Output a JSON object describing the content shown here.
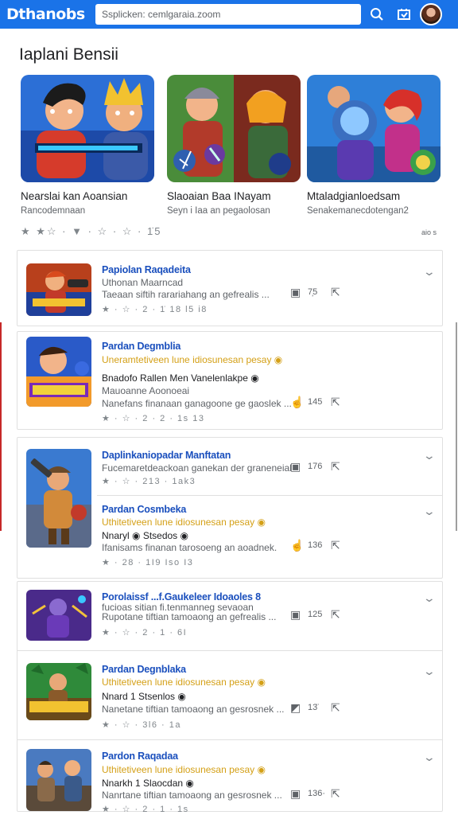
{
  "app": {
    "logo_text": "Dthanobs"
  },
  "search": {
    "placeholder": "Ssplicken: cemlgaraia.zoom"
  },
  "section": {
    "title": "Iaplani Bensii"
  },
  "featured": [
    {
      "title": "Nearslai kan Aoansian",
      "subtitle": "Rancodemnaan"
    },
    {
      "title": "Slaoaian Baa INayam",
      "subtitle": "Seyn i Iaa an pegaolosan"
    },
    {
      "title": "Mtaladgianloedsam",
      "subtitle": "Senakemanecdotengan2"
    }
  ],
  "featured_rating": {
    "text": "★ ★☆ · ▼ · ☆ · ☆ · 1̇5",
    "more": "aio s"
  },
  "list": [
    {
      "title": "Papiolan Raqadeita",
      "line1": "Uthonan Maarncad",
      "line2": "Taeaan siftih rarariahang an gefrealis ...",
      "rating": "★ · ☆ · 2 · 1̇ 18 l5 i8",
      "count": "7̦5"
    },
    {
      "title": "Pardan Degmblia",
      "line1": "Uneramtetiveen lune idiosunesan pesay ◉",
      "line2": "Bnadofo Rallen Men Vanelenlakpe ◉",
      "line3": "Mauoanne Aoonoeai",
      "line4": "Nanefans finanaan ganagoone ge gaoslek ...",
      "rating": "★ · ☆ · 2 ·  2 · 1s 13",
      "count": "145"
    },
    {
      "title": "Daplinkaniopadar Manftatan",
      "line1": "Fucemaretdeackoan ganekan der graneneial",
      "line2": "",
      "rating": "★ · ☆ · 213 · 1ak3",
      "count": "176"
    },
    {
      "title": "Pardan Cosmbeka",
      "line1": "Uthitetiveen lune idiosunesan pesay ◉",
      "line2": "Nnaryl ◉ Stsedos ◉",
      "line3": "Ifanisams finanan tarosoeng an aoadnek.",
      "rating": "★ · 28 · 1I9 Iso I3",
      "count": "136"
    },
    {
      "title": "Porolaissf ...f.Gaukeleer Idoaoles 8",
      "line1": "fucioas sitian fi.tenmanneg sevaoan",
      "line2": "Rupotane tiftian tamoaong an gefrealis ...",
      "rating": "★ · ☆ · 2  · 1 · 6I",
      "count": "125"
    },
    {
      "title": "Pardan Degnblaka",
      "line1": "Uthitetiveen lune idiosunesan pesay ◉",
      "line2": "Nnard 1 Stsenlos ◉",
      "line3": "Nanetane tiftian tamoaong an gesrosnek ...",
      "rating": "★ · ☆ · 3l6 · 1a",
      "count": "13̈"
    },
    {
      "title": "Pardon Raqadaa",
      "line1": "Uthitetiveen lune idiosunesan pesay ◉",
      "line2": "Nnarkh 1 Slaocdan ◉",
      "line3": "Nanrtane tiftian tamoaong an gesrosnek ...",
      "rating": "★ · ☆ · 2 · 1 · 1s",
      "count": "136·"
    }
  ]
}
